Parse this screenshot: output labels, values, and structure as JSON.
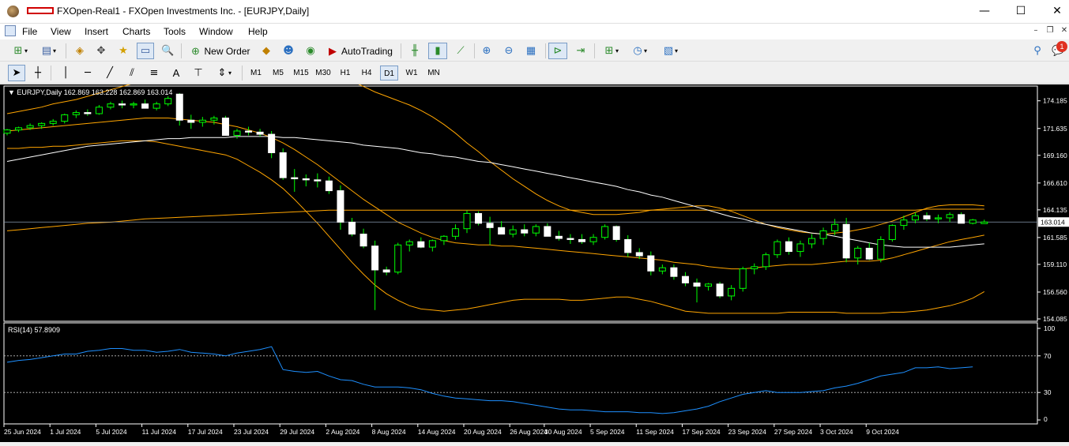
{
  "window": {
    "title": "FXOpen-Real1 - FXOpen Investments Inc. - [EURJPY,Daily]",
    "minimize": "—",
    "maximize": "☐",
    "close": "✕"
  },
  "menu": [
    "File",
    "View",
    "Insert",
    "Charts",
    "Tools",
    "Window",
    "Help"
  ],
  "mdi": {
    "minimize": "–",
    "restore": "❐",
    "close": "✕"
  },
  "toolbar1": {
    "new_order_label": "New Order",
    "autotrading_label": "AutoTrading",
    "notification_count": "1"
  },
  "toolbar2": {
    "timeframes": [
      "M1",
      "M5",
      "M15",
      "M30",
      "H1",
      "H4",
      "D1",
      "W1",
      "MN"
    ],
    "active_timeframe": "D1",
    "draw_tools": [
      "A"
    ]
  },
  "chart": {
    "info_line": "EURJPY,Daily  162.869 163.228 162.869 163.014",
    "current_price_label": "163.014",
    "price_ticks": [
      "174.185",
      "171.635",
      "169.160",
      "166.610",
      "164.135",
      "161.585",
      "159.110",
      "156.560",
      "154.085"
    ],
    "date_ticks": [
      "25 Jun 2024",
      "1 Jul 2024",
      "5 Jul 2024",
      "11 Jul 2024",
      "17 Jul 2024",
      "23 Jul 2024",
      "29 Jul 2024",
      "2 Aug 2024",
      "8 Aug 2024",
      "14 Aug 2024",
      "20 Aug 2024",
      "26 Aug 2024",
      "30 Aug 2024",
      "5 Sep 2024",
      "11 Sep 2024",
      "17 Sep 2024",
      "23 Sep 2024",
      "27 Sep 2024",
      "3 Oct 2024",
      "9 Oct 2024"
    ],
    "rsi_label": "RSI(14) 57.8909",
    "rsi_ticks": [
      "100",
      "70",
      "30",
      "0"
    ],
    "colors": {
      "background": "#000000",
      "bull_candle": "#00ff00",
      "bear_candle": "#ffffff",
      "ma": "#ffffff",
      "bollinger": "#ffa500",
      "rsi_line": "#1e90ff"
    }
  },
  "chart_data": {
    "type": "candlestick",
    "symbol": "EURJPY",
    "timeframe": "Daily",
    "ylim": [
      154.085,
      175.4
    ],
    "current": 163.014,
    "candles": [
      [
        171.2,
        171.6,
        171.0,
        171.5
      ],
      [
        171.5,
        171.8,
        171.3,
        171.7
      ],
      [
        171.7,
        172.1,
        171.5,
        171.9
      ],
      [
        171.9,
        172.2,
        171.6,
        172.1
      ],
      [
        172.1,
        172.5,
        171.9,
        172.3
      ],
      [
        172.3,
        173.0,
        172.1,
        172.9
      ],
      [
        172.9,
        173.3,
        172.6,
        173.1
      ],
      [
        173.1,
        173.4,
        172.8,
        173.0
      ],
      [
        173.0,
        173.8,
        172.9,
        173.6
      ],
      [
        173.6,
        174.1,
        173.4,
        173.9
      ],
      [
        173.9,
        174.2,
        173.5,
        173.8
      ],
      [
        173.8,
        174.1,
        173.5,
        173.9
      ],
      [
        173.9,
        174.3,
        173.6,
        173.5
      ],
      [
        173.5,
        174.1,
        173.3,
        173.9
      ],
      [
        173.9,
        174.6,
        173.7,
        174.4
      ],
      [
        174.8,
        174.9,
        171.9,
        172.4
      ],
      [
        172.4,
        172.9,
        171.6,
        172.2
      ],
      [
        172.2,
        172.7,
        171.8,
        172.4
      ],
      [
        172.4,
        172.8,
        172.0,
        172.6
      ],
      [
        172.6,
        172.8,
        171.4,
        171.0
      ],
      [
        171.0,
        171.6,
        170.7,
        171.4
      ],
      [
        171.4,
        171.8,
        171.0,
        171.3
      ],
      [
        171.3,
        171.6,
        170.9,
        171.1
      ],
      [
        171.1,
        171.4,
        168.9,
        169.4
      ],
      [
        169.4,
        169.8,
        166.9,
        167.1
      ],
      [
        167.1,
        167.9,
        165.8,
        167.0
      ],
      [
        167.0,
        167.4,
        166.3,
        166.9
      ],
      [
        166.9,
        167.5,
        166.2,
        166.8
      ],
      [
        166.8,
        167.2,
        165.6,
        165.9
      ],
      [
        165.9,
        166.4,
        162.3,
        163.0
      ],
      [
        163.0,
        163.4,
        161.7,
        161.9
      ],
      [
        161.9,
        162.4,
        160.6,
        160.8
      ],
      [
        160.8,
        161.3,
        154.9,
        158.6
      ],
      [
        158.6,
        158.9,
        158.1,
        158.4
      ],
      [
        158.4,
        161.1,
        158.2,
        160.9
      ],
      [
        160.9,
        161.4,
        160.3,
        161.2
      ],
      [
        161.2,
        161.6,
        160.6,
        160.7
      ],
      [
        160.7,
        161.4,
        160.3,
        161.3
      ],
      [
        161.3,
        161.8,
        160.9,
        161.7
      ],
      [
        161.7,
        162.8,
        161.4,
        162.4
      ],
      [
        162.4,
        164.1,
        162.0,
        163.8
      ],
      [
        163.8,
        164.0,
        162.7,
        162.9
      ],
      [
        162.9,
        163.5,
        160.9,
        162.5
      ],
      [
        162.5,
        163.1,
        161.9,
        161.9
      ],
      [
        161.9,
        162.7,
        161.6,
        162.3
      ],
      [
        162.3,
        162.8,
        161.7,
        162.0
      ],
      [
        162.0,
        162.8,
        161.7,
        162.6
      ],
      [
        162.6,
        162.9,
        161.7,
        161.7
      ],
      [
        161.7,
        162.2,
        161.3,
        161.5
      ],
      [
        161.5,
        161.9,
        161.0,
        161.4
      ],
      [
        161.4,
        161.9,
        161.0,
        161.2
      ],
      [
        161.2,
        161.9,
        160.9,
        161.6
      ],
      [
        161.6,
        162.8,
        161.4,
        162.6
      ],
      [
        162.6,
        162.7,
        161.2,
        161.4
      ],
      [
        161.4,
        161.8,
        159.8,
        160.2
      ],
      [
        160.2,
        160.6,
        159.6,
        159.9
      ],
      [
        159.9,
        160.3,
        158.1,
        158.5
      ],
      [
        158.5,
        159.1,
        158.2,
        158.8
      ],
      [
        158.8,
        159.1,
        157.7,
        158.0
      ],
      [
        158.0,
        158.4,
        157.1,
        157.4
      ],
      [
        157.4,
        157.8,
        155.6,
        157.1
      ],
      [
        157.1,
        157.4,
        156.7,
        157.3
      ],
      [
        157.3,
        157.5,
        156.0,
        156.2
      ],
      [
        156.2,
        157.2,
        155.8,
        156.9
      ],
      [
        156.9,
        158.9,
        156.6,
        158.7
      ],
      [
        158.7,
        159.2,
        158.2,
        158.9
      ],
      [
        158.9,
        160.2,
        158.6,
        160.0
      ],
      [
        160.0,
        161.4,
        159.7,
        161.2
      ],
      [
        161.2,
        161.6,
        160.0,
        160.3
      ],
      [
        160.3,
        161.3,
        159.8,
        161.0
      ],
      [
        161.0,
        161.9,
        160.6,
        161.5
      ],
      [
        161.5,
        162.5,
        160.9,
        162.2
      ],
      [
        162.2,
        163.3,
        161.8,
        162.8
      ],
      [
        162.8,
        163.4,
        159.3,
        159.7
      ],
      [
        159.7,
        160.8,
        159.1,
        160.6
      ],
      [
        160.6,
        161.1,
        159.5,
        159.6
      ],
      [
        159.6,
        161.7,
        159.3,
        161.4
      ],
      [
        161.4,
        162.8,
        161.2,
        162.7
      ],
      [
        162.7,
        163.6,
        162.3,
        163.2
      ],
      [
        163.2,
        163.9,
        162.9,
        163.6
      ],
      [
        163.6,
        163.9,
        163.1,
        163.3
      ],
      [
        163.3,
        163.7,
        162.9,
        163.4
      ],
      [
        163.4,
        163.9,
        163.0,
        163.7
      ],
      [
        163.7,
        163.9,
        163.0,
        162.9
      ],
      [
        162.9,
        163.3,
        162.8,
        163.2
      ],
      [
        162.869,
        163.228,
        162.869,
        163.014
      ]
    ],
    "ma_white": [
      168.6,
      168.8,
      169.0,
      169.2,
      169.4,
      169.6,
      169.8,
      170.0,
      170.1,
      170.2,
      170.3,
      170.4,
      170.5,
      170.6,
      170.7,
      170.7,
      170.8,
      170.8,
      170.8,
      170.8,
      170.9,
      170.9,
      170.9,
      170.9,
      170.8,
      170.8,
      170.7,
      170.6,
      170.5,
      170.4,
      170.3,
      170.1,
      170.0,
      169.9,
      169.8,
      169.6,
      169.4,
      169.3,
      169.1,
      169.0,
      168.8,
      168.6,
      168.5,
      168.3,
      168.1,
      167.9,
      167.7,
      167.5,
      167.3,
      167.1,
      166.9,
      166.7,
      166.5,
      166.3,
      166.0,
      165.8,
      165.5,
      165.3,
      165.0,
      164.7,
      164.4,
      164.1,
      163.8,
      163.5,
      163.3,
      163.0,
      162.8,
      162.6,
      162.4,
      162.2,
      162.0,
      161.9,
      161.7,
      161.5,
      161.3,
      161.1,
      160.9,
      160.8,
      160.7,
      160.7,
      160.7,
      160.7,
      160.7,
      160.8,
      160.9,
      161.0
    ],
    "ma_orange_flat": [
      162.2,
      162.3,
      162.4,
      162.5,
      162.6,
      162.7,
      162.8,
      162.9,
      162.95,
      163.0,
      163.1,
      163.2,
      163.3,
      163.35,
      163.4,
      163.45,
      163.5,
      163.55,
      163.6,
      163.65,
      163.7,
      163.75,
      163.8,
      163.85,
      163.9,
      163.95,
      164.0,
      164.05,
      164.1,
      164.1,
      164.1,
      164.1,
      164.1,
      164.1,
      164.1,
      164.1,
      164.1,
      164.1,
      164.1,
      164.1,
      164.1,
      164.1,
      164.1,
      164.1,
      164.1,
      164.1,
      164.1,
      164.1,
      164.1,
      164.1,
      164.1,
      164.1,
      164.1,
      164.1,
      164.1,
      164.1,
      164.1,
      164.1,
      164.1,
      164.1,
      164.1,
      164.1,
      164.1,
      164.1,
      164.1,
      164.1,
      164.1,
      164.1,
      164.1,
      164.1,
      164.1,
      164.1,
      164.1,
      164.1,
      164.1,
      164.1,
      164.1,
      164.1,
      164.1,
      164.1,
      164.2,
      164.2,
      164.2,
      164.2,
      164.2,
      164.2
    ],
    "bb_upper": [
      173.0,
      173.2,
      173.4,
      173.6,
      173.9,
      174.1,
      174.3,
      174.6,
      174.9,
      175.2,
      175.5,
      175.8,
      176.0,
      176.2,
      176.4,
      176.6,
      176.7,
      176.8,
      176.9,
      177.0,
      177.0,
      177.1,
      177.1,
      177.1,
      177.1,
      177.0,
      176.9,
      176.8,
      176.6,
      176.4,
      176.0,
      175.5,
      175.0,
      174.6,
      174.2,
      173.8,
      173.3,
      172.7,
      172.0,
      171.2,
      170.3,
      169.5,
      168.6,
      167.8,
      167.0,
      166.3,
      165.6,
      165.0,
      164.5,
      164.1,
      163.9,
      163.7,
      163.7,
      163.7,
      163.8,
      163.9,
      164.1,
      164.2,
      164.3,
      164.4,
      164.5,
      164.5,
      164.3,
      164.0,
      163.6,
      163.2,
      162.8,
      162.5,
      162.3,
      162.1,
      162.0,
      161.9,
      162.0,
      162.1,
      162.3,
      162.5,
      162.8,
      163.1,
      163.5,
      163.9,
      164.3,
      164.5,
      164.6,
      164.6,
      164.6,
      164.5
    ],
    "bb_middle": [
      171.4,
      171.5,
      171.6,
      171.7,
      171.8,
      171.9,
      172.0,
      172.1,
      172.2,
      172.3,
      172.4,
      172.5,
      172.6,
      172.6,
      172.6,
      172.5,
      172.4,
      172.3,
      172.2,
      172.0,
      171.8,
      171.5,
      171.2,
      170.8,
      170.3,
      169.7,
      169.0,
      168.3,
      167.5,
      166.7,
      165.9,
      165.1,
      164.4,
      163.7,
      163.0,
      162.5,
      162.0,
      161.6,
      161.3,
      161.1,
      161.0,
      160.9,
      160.9,
      160.8,
      160.8,
      160.7,
      160.6,
      160.5,
      160.4,
      160.3,
      160.2,
      160.1,
      160.0,
      159.9,
      159.8,
      159.7,
      159.6,
      159.5,
      159.3,
      159.2,
      159.1,
      158.9,
      158.8,
      158.7,
      158.7,
      158.8,
      158.9,
      159.0,
      159.1,
      159.1,
      159.1,
      159.2,
      159.3,
      159.4,
      159.4,
      159.4,
      159.5,
      159.7,
      160.0,
      160.3,
      160.6,
      160.9,
      161.2,
      161.4,
      161.6,
      161.8
    ],
    "bb_lower": [
      169.8,
      169.8,
      169.9,
      169.9,
      170.0,
      170.0,
      170.1,
      170.2,
      170.3,
      170.4,
      170.5,
      170.5,
      170.5,
      170.4,
      170.2,
      170.0,
      169.8,
      169.6,
      169.4,
      169.2,
      168.8,
      168.2,
      167.6,
      166.9,
      166.1,
      165.1,
      164.0,
      162.9,
      161.7,
      160.5,
      159.3,
      158.2,
      157.2,
      156.4,
      155.8,
      155.3,
      155.0,
      154.9,
      154.8,
      154.9,
      155.0,
      155.2,
      155.4,
      155.6,
      155.8,
      155.9,
      155.9,
      155.9,
      155.9,
      155.8,
      155.8,
      155.9,
      156.0,
      156.1,
      156.1,
      155.9,
      155.7,
      155.4,
      155.1,
      154.8,
      154.7,
      154.6,
      154.6,
      154.6,
      154.6,
      154.6,
      154.6,
      154.6,
      154.7,
      154.7,
      154.7,
      154.7,
      154.7,
      154.6,
      154.6,
      154.6,
      154.6,
      154.7,
      154.7,
      154.8,
      154.9,
      155.1,
      155.3,
      155.6,
      156.0,
      156.6
    ],
    "rsi": [
      63,
      65,
      66,
      68,
      70,
      72,
      72,
      75,
      76,
      78,
      78,
      76,
      76,
      74,
      75,
      77,
      74,
      73,
      72,
      70,
      73,
      75,
      77,
      80,
      55,
      53,
      52,
      53,
      48,
      44,
      43,
      39,
      36,
      36,
      36,
      35,
      33,
      29,
      26,
      24,
      23,
      22,
      21,
      21,
      20,
      18,
      16,
      14,
      12,
      11,
      11,
      10,
      9,
      9,
      9,
      8,
      8,
      7,
      8,
      10,
      12,
      15,
      20,
      24,
      28,
      30,
      32,
      30,
      30,
      30,
      31,
      32,
      35,
      37,
      40,
      44,
      48,
      50,
      52,
      57,
      57,
      58,
      56,
      57,
      57.9
    ],
    "rsi_levels": [
      70,
      30
    ]
  }
}
